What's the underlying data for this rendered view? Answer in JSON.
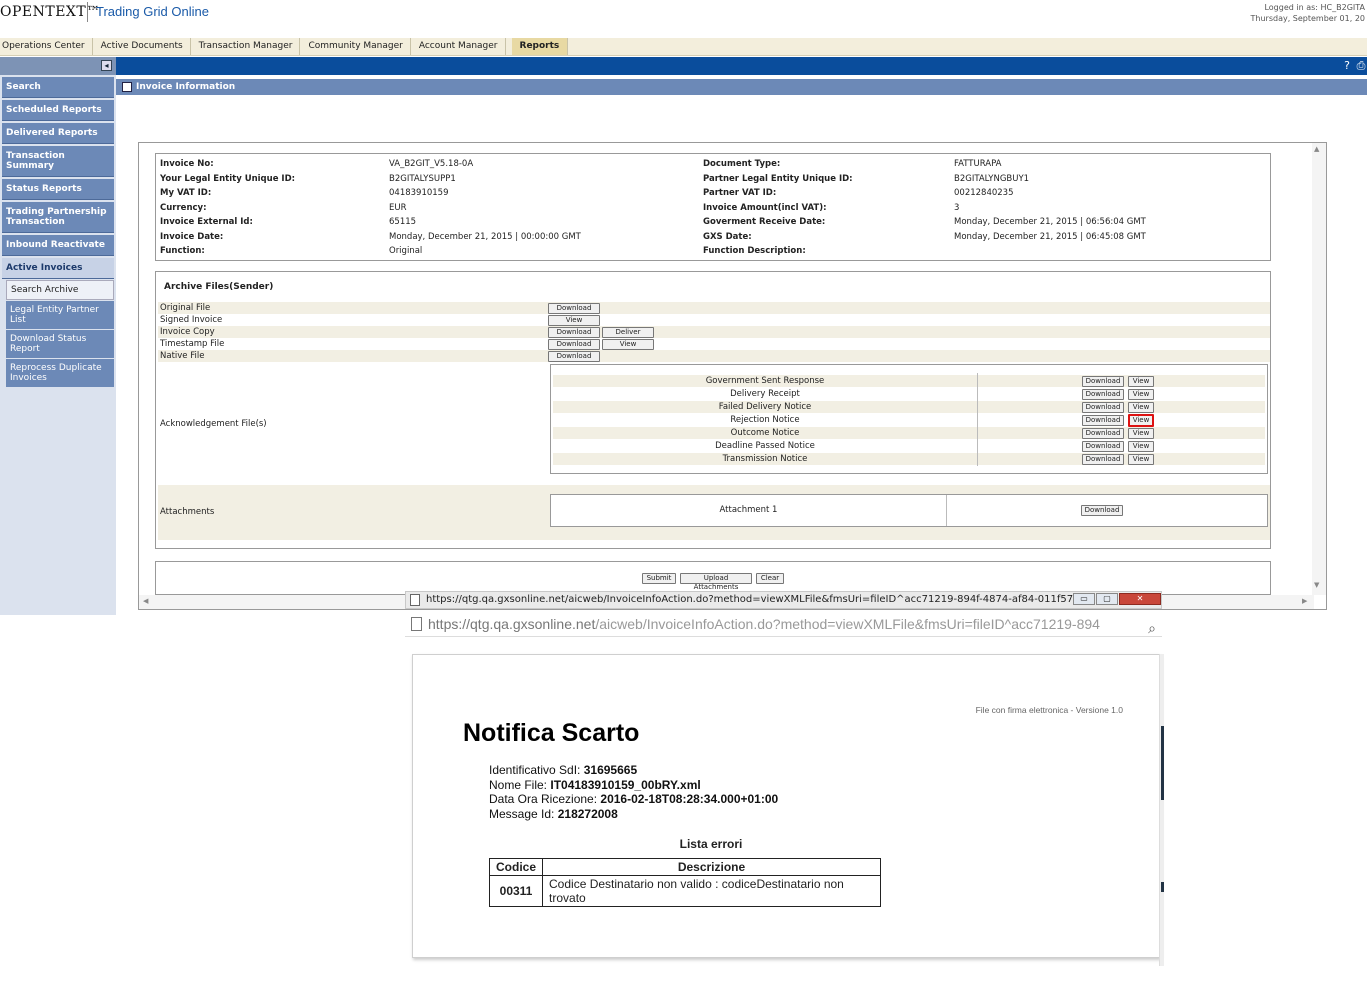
{
  "header": {
    "logo": "OPENTEXT™",
    "product": "Trading Grid Online",
    "logged_in": "Logged in as: HC_B2GITA",
    "date": "Thursday, September 01, 20"
  },
  "nav": {
    "tabs": [
      "Operations Center",
      "Active Documents",
      "Transaction Manager",
      "Community Manager",
      "Account Manager",
      "Reports"
    ]
  },
  "sidebar": {
    "main": [
      "Search",
      "Scheduled Reports",
      "Delivered Reports",
      "Transaction Summary",
      "Status Reports",
      "Trading Partnership Transaction",
      "Inbound Reactivate",
      "Active Invoices"
    ],
    "sub": [
      "Search Archive",
      "Legal Entity Partner List",
      "Download Status Report",
      "Reprocess Duplicate Invoices"
    ]
  },
  "section_title": "Invoice Information",
  "invoice": {
    "left": [
      {
        "label": "Invoice No:",
        "value": "VA_B2GIT_V5.18-0A"
      },
      {
        "label": "Your Legal Entity Unique ID:",
        "value": "B2GITALYSUPP1"
      },
      {
        "label": "My VAT ID:",
        "value": "04183910159"
      },
      {
        "label": "Currency:",
        "value": "EUR"
      },
      {
        "label": "Invoice External Id:",
        "value": "65115"
      },
      {
        "label": "Invoice Date:",
        "value": "Monday, December 21, 2015 | 00:00:00 GMT"
      },
      {
        "label": "Function:",
        "value": "Original"
      }
    ],
    "right": [
      {
        "label": "Document Type:",
        "value": "FATTURAPA"
      },
      {
        "label": "Partner Legal Entity Unique ID:",
        "value": "B2GITALYNGBUY1"
      },
      {
        "label": "Partner VAT ID:",
        "value": "00212840235"
      },
      {
        "label": "Invoice Amount(incl VAT):",
        "value": "3"
      },
      {
        "label": "Goverment Receive Date:",
        "value": "Monday, December 21, 2015 | 06:56:04 GMT"
      },
      {
        "label": "GXS Date:",
        "value": "Monday, December 21, 2015 | 06:45:08 GMT"
      },
      {
        "label": "Function Description:",
        "value": ""
      }
    ]
  },
  "archive": {
    "title": "Archive Files(Sender)",
    "files": [
      {
        "name": "Original File",
        "buttons": [
          "Download"
        ]
      },
      {
        "name": "Signed Invoice",
        "buttons": [
          "View"
        ]
      },
      {
        "name": "Invoice Copy",
        "buttons": [
          "Download",
          "Deliver"
        ]
      },
      {
        "name": "Timestamp File",
        "buttons": [
          "Download",
          "View"
        ]
      },
      {
        "name": "Native File",
        "buttons": [
          "Download"
        ]
      }
    ],
    "ack_label": "Acknowledgement File(s)",
    "acks": [
      "Government Sent Response",
      "Delivery Receipt",
      "Failed Delivery Notice",
      "Rejection Notice",
      "Outcome Notice",
      "Deadline Passed Notice",
      "Transmission Notice"
    ],
    "download_label": "Download",
    "view_label": "View",
    "attachments_label": "Attachments",
    "attachment_name": "Attachment 1"
  },
  "actions": [
    "Submit",
    "Upload Attachments",
    "Clear"
  ],
  "popup": {
    "title_url": "https://qtg.qa.gxsonline.net/aicweb/InvoiceInfoAction.do?method=viewXMLFile&fmsUri=fileID^acc71219-894f-4874-af84-011f57...",
    "addr_host": "https://qtg.qa.gxsonline.net",
    "addr_path": "/aicweb/InvoiceInfoAction.do?method=viewXMLFile&fmsUri=fileID^acc71219-894",
    "signature": "File con firma elettronica - Versione 1.0",
    "title": "Notifica Scarto",
    "meta": [
      {
        "label": "Identificativo SdI:",
        "value": "31695665"
      },
      {
        "label": "Nome File:",
        "value": "IT04183910159_00bRY.xml"
      },
      {
        "label": "Data Ora Ricezione:",
        "value": "2016-02-18T08:28:34.000+01:00"
      },
      {
        "label": "Message Id:",
        "value": "218272008"
      }
    ],
    "errors_title": "Lista errori",
    "error_headers": [
      "Codice",
      "Descrizione"
    ],
    "errors": [
      {
        "code": "00311",
        "desc": "Codice Destinatario non valido : codiceDestinatario non trovato"
      }
    ]
  }
}
